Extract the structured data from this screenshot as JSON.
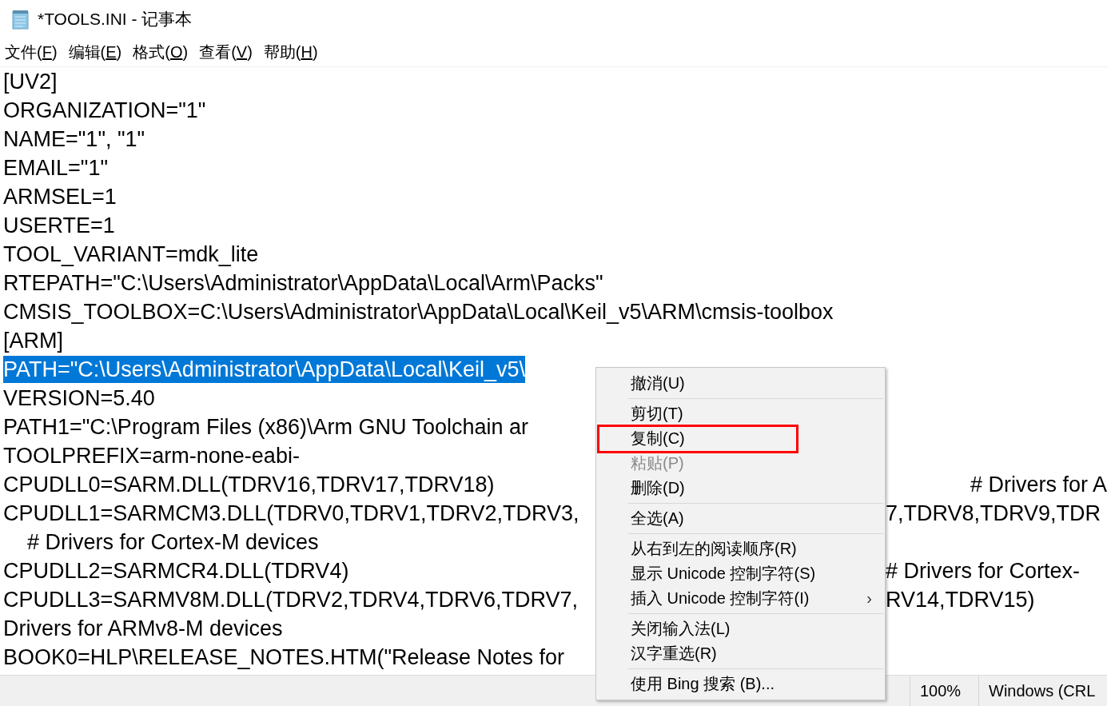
{
  "window": {
    "title": "*TOOLS.INI - 记事本"
  },
  "menu_bar": [
    "文件(F)",
    "编辑(E)",
    "格式(O)",
    "查看(V)",
    "帮助(H)"
  ],
  "editor": {
    "lines": [
      {
        "text": "[UV2]",
        "selected": false
      },
      {
        "text": "ORGANIZATION=\"1\"",
        "selected": false
      },
      {
        "text": "NAME=\"1\", \"1\"",
        "selected": false
      },
      {
        "text": "EMAIL=\"1\"",
        "selected": false
      },
      {
        "text": "ARMSEL=1",
        "selected": false
      },
      {
        "text": "USERTE=1",
        "selected": false
      },
      {
        "text": "TOOL_VARIANT=mdk_lite",
        "selected": false
      },
      {
        "text": "RTEPATH=\"C:\\Users\\Administrator\\AppData\\Local\\Arm\\Packs\"",
        "selected": false
      },
      {
        "text": "CMSIS_TOOLBOX=C:\\Users\\Administrator\\AppData\\Local\\Keil_v5\\ARM\\cmsis-toolbox",
        "selected": false
      },
      {
        "text": "[ARM]",
        "selected": false
      },
      {
        "text": "PATH=\"C:\\Users\\Administrator\\AppData\\Local\\Keil_v5\\",
        "selected": true
      },
      {
        "text": "VERSION=5.40",
        "selected": false
      },
      {
        "text": "PATH1=\"C:\\Program Files (x86)\\Arm GNU Toolchain ar",
        "selected": false
      },
      {
        "text": "TOOLPREFIX=arm-none-eabi-",
        "selected": false
      },
      {
        "text": "CPUDLL0=SARM.DLL(TDRV16,TDRV17,TDRV18)",
        "right": "# Drivers for A",
        "selected": false
      },
      {
        "text": "CPUDLL1=SARMCM3.DLL(TDRV0,TDRV1,TDRV2,TDRV3,",
        "right": "7,TDRV8,TDRV9,TDR",
        "selected": false
      },
      {
        "text": "    # Drivers for Cortex-M devices",
        "selected": false
      },
      {
        "text": "CPUDLL2=SARMCR4.DLL(TDRV4)",
        "right": "# Drivers for Cortex-",
        "selected": false
      },
      {
        "text": "CPUDLL3=SARMV8M.DLL(TDRV2,TDRV4,TDRV6,TDRV7,",
        "right": "RV14,TDRV15)",
        "selected": false
      },
      {
        "text": "Drivers for ARMv8-M devices",
        "selected": false
      },
      {
        "text": "BOOK0=HLP\\RELEASE_NOTES.HTM(\"Release Notes for",
        "selected": false
      }
    ]
  },
  "context_menu": {
    "items": [
      {
        "kind": "item",
        "label": "撤消(U)",
        "disabled": false,
        "highlighted": false
      },
      {
        "kind": "separator"
      },
      {
        "kind": "item",
        "label": "剪切(T)",
        "disabled": false,
        "highlighted": false
      },
      {
        "kind": "item",
        "label": "复制(C)",
        "disabled": false,
        "highlighted": true
      },
      {
        "kind": "item",
        "label": "粘贴(P)",
        "disabled": true,
        "highlighted": false
      },
      {
        "kind": "item",
        "label": "删除(D)",
        "disabled": false,
        "highlighted": false
      },
      {
        "kind": "separator"
      },
      {
        "kind": "item",
        "label": "全选(A)",
        "disabled": false,
        "highlighted": false
      },
      {
        "kind": "separator"
      },
      {
        "kind": "item",
        "label": "从右到左的阅读顺序(R)",
        "disabled": false,
        "highlighted": false
      },
      {
        "kind": "item",
        "label": "显示 Unicode 控制字符(S)",
        "disabled": false,
        "highlighted": false
      },
      {
        "kind": "item",
        "label": "插入 Unicode 控制字符(I)",
        "submenu": "›",
        "disabled": false,
        "highlighted": false
      },
      {
        "kind": "separator"
      },
      {
        "kind": "item",
        "label": "关闭输入法(L)",
        "disabled": false,
        "highlighted": false
      },
      {
        "kind": "item",
        "label": "汉字重选(R)",
        "disabled": false,
        "highlighted": false
      },
      {
        "kind": "separator"
      },
      {
        "kind": "item",
        "label": "使用 Bing 搜索 (B)...",
        "disabled": false,
        "highlighted": false
      }
    ]
  },
  "status_bar": {
    "zoom": "100%",
    "line_ending": "Windows (CRL"
  }
}
